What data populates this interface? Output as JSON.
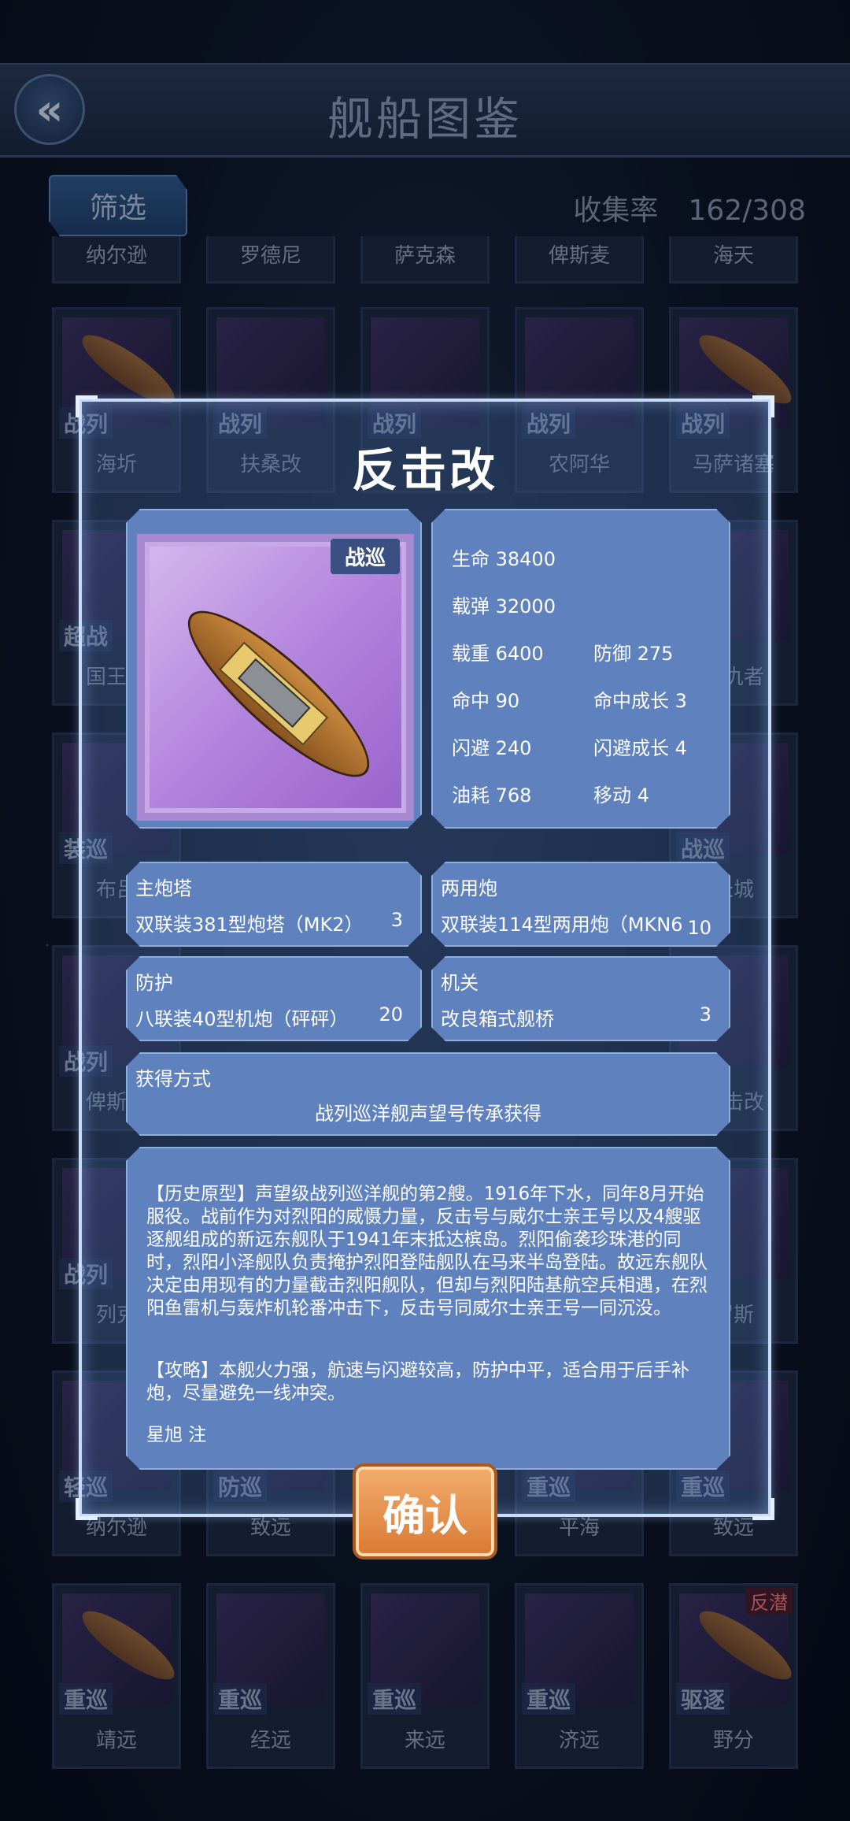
{
  "header": {
    "back_icon": "double-chevron-left-icon",
    "title": "舰船图鉴"
  },
  "toolbar": {
    "filter_label": "筛选",
    "collect_label": "收集率",
    "collect_value": "162/308"
  },
  "grid": {
    "row0": [
      "纳尔逊",
      "罗德尼",
      "萨克森",
      "俾斯麦",
      "海天"
    ],
    "row1": [
      {
        "type": "战列",
        "name": "海圻"
      },
      {
        "type": "战列",
        "name": "扶桑改"
      },
      {
        "type": "战列",
        "name": ""
      },
      {
        "type": "战列",
        "name": "农阿华"
      },
      {
        "type": "战列",
        "name": "马萨诸塞"
      }
    ],
    "row2": [
      {
        "type": "超战",
        "name": "国王乔"
      },
      {
        "name": "复仇者"
      }
    ],
    "row3": [
      {
        "type": "装巡",
        "name": "布吕"
      },
      {
        "type": "战巡",
        "name": "长城"
      }
    ],
    "row4": [
      {
        "type": "战列",
        "name": "俾斯麦"
      },
      {
        "type": "",
        "name": "反击改"
      }
    ],
    "row5": [
      {
        "type": "战列",
        "name": "列克"
      },
      {
        "type": "",
        "name": "罗斯"
      }
    ],
    "row6": [
      {
        "type": "轻巡",
        "name": "纳尔逊"
      },
      {
        "type": "防巡",
        "name": "致远"
      },
      {
        "type": "",
        "name": ""
      },
      {
        "type": "重巡",
        "name": "平海"
      },
      {
        "type": "重巡",
        "name": "致远"
      }
    ],
    "row7": [
      {
        "type": "重巡",
        "name": "靖远"
      },
      {
        "type": "重巡",
        "name": "经远"
      },
      {
        "type": "重巡",
        "name": "来远"
      },
      {
        "type": "重巡",
        "name": "济远"
      },
      {
        "type": "驱逐",
        "name": "野分",
        "tag": "反潜"
      }
    ]
  },
  "modal": {
    "title": "反击改",
    "ship_type": "战巡",
    "stats": {
      "hp": "生命 38400",
      "ammo": "载弹 32000",
      "load": "载重 6400",
      "defense": "防御 275",
      "accuracy": "命中 90",
      "accuracy_growth": "命中成长 3",
      "evasion": "闪避 240",
      "evasion_growth": "闪避成长 4",
      "fuel": "油耗 768",
      "move": "移动 4"
    },
    "slots": {
      "main_label": "主炮塔",
      "main_item": "双联装381型炮塔（MK2）",
      "main_count": "3",
      "dual_label": "两用炮",
      "dual_item": "双联装114型两用炮（MKN6",
      "dual_count": "10",
      "defense_label": "防护",
      "defense_item": "八联装40型机炮（砰砰）",
      "defense_count": "20",
      "engine_label": "机关",
      "engine_item": "改良箱式舰桥",
      "engine_count": "3"
    },
    "obtain_label": "获得方式",
    "obtain_text": "战列巡洋舰声望号传承获得",
    "desc": {
      "history": "【历史原型】声望级战列巡洋舰的第2艘。1916年下水，同年8月开始服役。战前作为对烈阳的威慑力量，反击号与威尔士亲王号以及4艘驱逐舰组成的新远东舰队于1941年末抵达槟岛。烈阳偷袭珍珠港的同时，烈阳小泽舰队负责掩护烈阳登陆舰队在马来半岛登陆。故远东舰队决定由用现有的力量截击烈阳舰队，但却与烈阳陆基航空兵相遇，在烈阳鱼雷机与轰炸机轮番冲击下，反击号同威尔士亲王号一同沉没。",
      "strategy": "【攻略】本舰火力强，航速与闪避较高，防护中平，适合用于后手补炮，尽量避免一线冲突。",
      "author": "星旭 注"
    },
    "confirm_label": "确认"
  }
}
